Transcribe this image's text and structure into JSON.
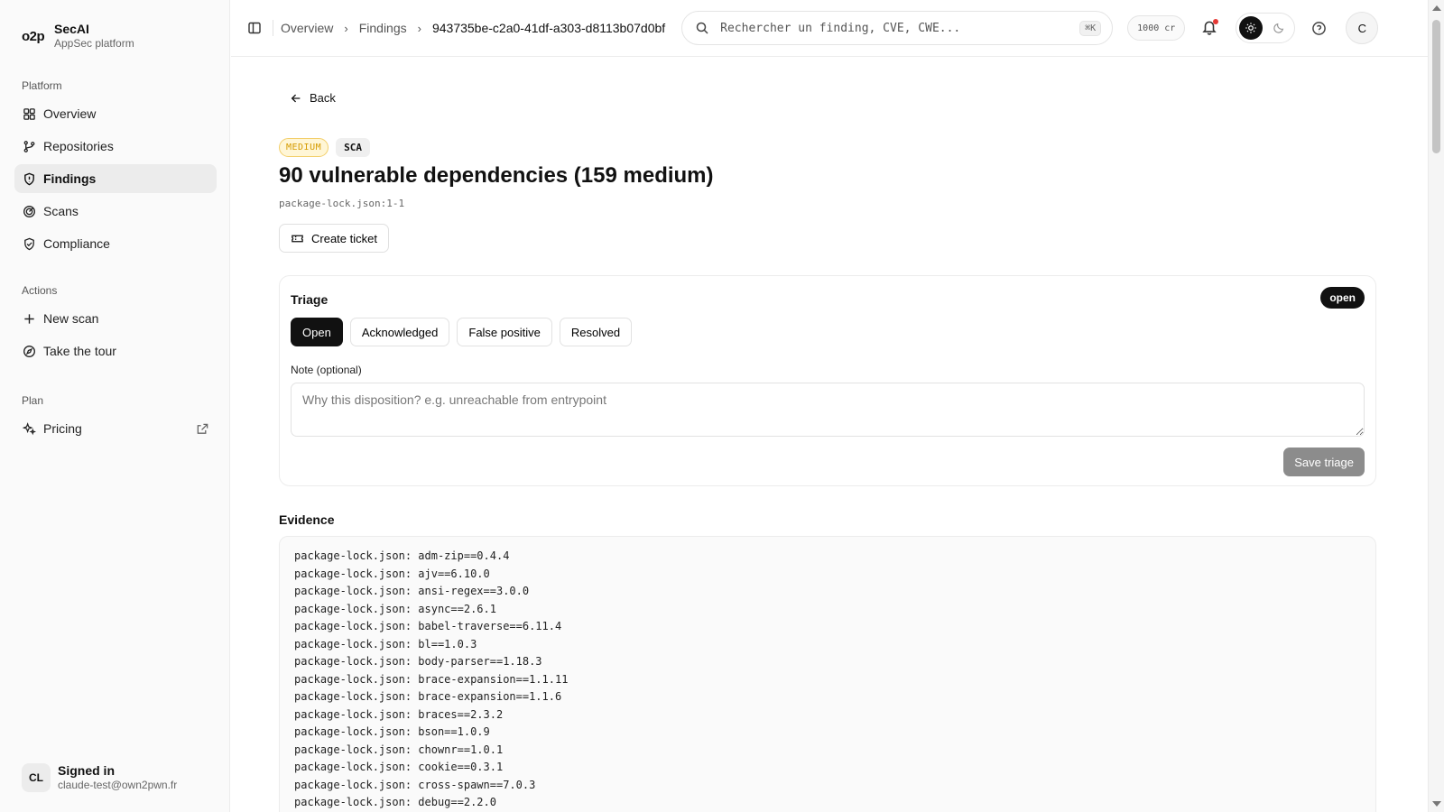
{
  "brand": {
    "logo": "o2p",
    "name": "SecAI",
    "subtitle": "AppSec platform"
  },
  "sidebar": {
    "sections": [
      {
        "heading": "Platform",
        "items": [
          {
            "label": "Overview",
            "icon": "grid-icon"
          },
          {
            "label": "Repositories",
            "icon": "git-branch-icon"
          },
          {
            "label": "Findings",
            "icon": "shield-alert-icon",
            "active": true
          },
          {
            "label": "Scans",
            "icon": "radar-icon"
          },
          {
            "label": "Compliance",
            "icon": "shield-check-icon"
          }
        ]
      },
      {
        "heading": "Actions",
        "items": [
          {
            "label": "New scan",
            "icon": "plus-icon"
          },
          {
            "label": "Take the tour",
            "icon": "compass-icon"
          }
        ]
      },
      {
        "heading": "Plan",
        "items": [
          {
            "label": "Pricing",
            "icon": "sparkles-icon",
            "external": true
          }
        ]
      }
    ],
    "signed": {
      "initials": "CL",
      "title": "Signed in",
      "email": "claude-test@own2pwn.fr"
    }
  },
  "topbar": {
    "breadcrumbs": [
      "Overview",
      "Findings",
      "943735be-c2a0-41df-a303-d8113b07d0bf"
    ],
    "search_placeholder": "Rechercher un finding, CVE, CWE...",
    "search_shortcut": "⌘K",
    "credits": "1000 cr",
    "user_initial": "C"
  },
  "finding": {
    "back_label": "Back",
    "severity": "MEDIUM",
    "type": "SCA",
    "title": "90 vulnerable dependencies (159 medium)",
    "location": "package-lock.json:1-1",
    "create_ticket_label": "Create ticket"
  },
  "triage": {
    "title": "Triage",
    "status": "open",
    "options": [
      "Open",
      "Acknowledged",
      "False positive",
      "Resolved"
    ],
    "selected": "Open",
    "note_label": "Note (optional)",
    "note_placeholder": "Why this disposition? e.g. unreachable from entrypoint",
    "save_label": "Save triage"
  },
  "evidence": {
    "title": "Evidence",
    "lines": [
      "package-lock.json: adm-zip==0.4.4",
      "package-lock.json: ajv==6.10.0",
      "package-lock.json: ansi-regex==3.0.0",
      "package-lock.json: async==2.6.1",
      "package-lock.json: babel-traverse==6.11.4",
      "package-lock.json: bl==1.0.3",
      "package-lock.json: body-parser==1.18.3",
      "package-lock.json: brace-expansion==1.1.11",
      "package-lock.json: brace-expansion==1.1.6",
      "package-lock.json: braces==2.3.2",
      "package-lock.json: bson==1.0.9",
      "package-lock.json: chownr==1.0.1",
      "package-lock.json: cookie==0.3.1",
      "package-lock.json: cross-spawn==7.0.3",
      "package-lock.json: debug==2.2.0"
    ]
  }
}
